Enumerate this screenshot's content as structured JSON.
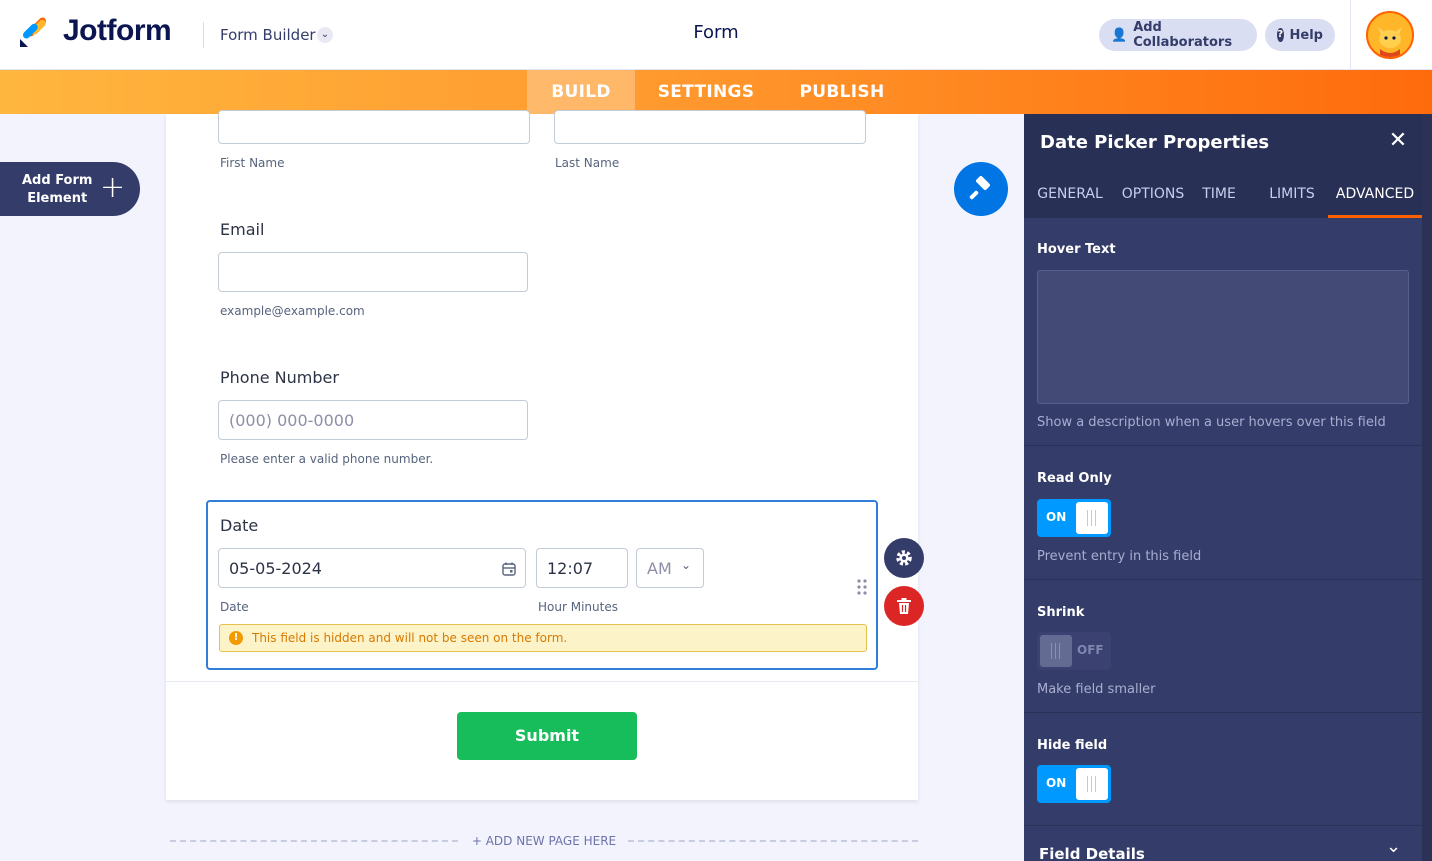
{
  "header": {
    "brand": "Jotform",
    "builder_label": "Form Builder",
    "form_title": "Form",
    "collaborators_label": "Add Collaborators",
    "help_label": "Help"
  },
  "nav": {
    "tabs": [
      "BUILD",
      "SETTINGS",
      "PUBLISH"
    ],
    "active": "BUILD"
  },
  "sidebar": {
    "add_element_line1": "Add Form",
    "add_element_line2": "Element"
  },
  "form": {
    "first_name_label": "First Name",
    "last_name_label": "Last Name",
    "email_label": "Email",
    "email_sublabel": "example@example.com",
    "phone_label": "Phone Number",
    "phone_placeholder": "(000) 000-0000",
    "phone_sublabel": "Please enter a valid phone number.",
    "date_label": "Date",
    "date_value": "05-05-2024",
    "time_value": "12:07",
    "ampm_value": "AM",
    "date_sublabel": "Date",
    "time_sublabel": "Hour Minutes",
    "hidden_warning": "This field is hidden and will not be seen on the form.",
    "submit_label": "Submit",
    "add_page_label": "+ ADD NEW PAGE HERE"
  },
  "panel": {
    "title": "Date Picker Properties",
    "tabs": [
      "GENERAL",
      "OPTIONS",
      "TIME",
      "LIMITS",
      "ADVANCED"
    ],
    "active_tab": "ADVANCED",
    "hover_text": {
      "title": "Hover Text",
      "value": "",
      "desc": "Show a description when a user hovers over this field"
    },
    "read_only": {
      "title": "Read Only",
      "state": "ON",
      "desc": "Prevent entry in this field"
    },
    "shrink": {
      "title": "Shrink",
      "state": "OFF",
      "desc": "Make field smaller"
    },
    "hide_field": {
      "title": "Hide field",
      "state": "ON"
    },
    "field_details": {
      "title": "Field Details"
    }
  },
  "colors": {
    "accent_orange": "#ff6100",
    "toggle_on": "#0099ff",
    "submit_green": "#18bd5b",
    "panel_bg": "#343c6a",
    "selected_border": "#2f7ed8"
  }
}
